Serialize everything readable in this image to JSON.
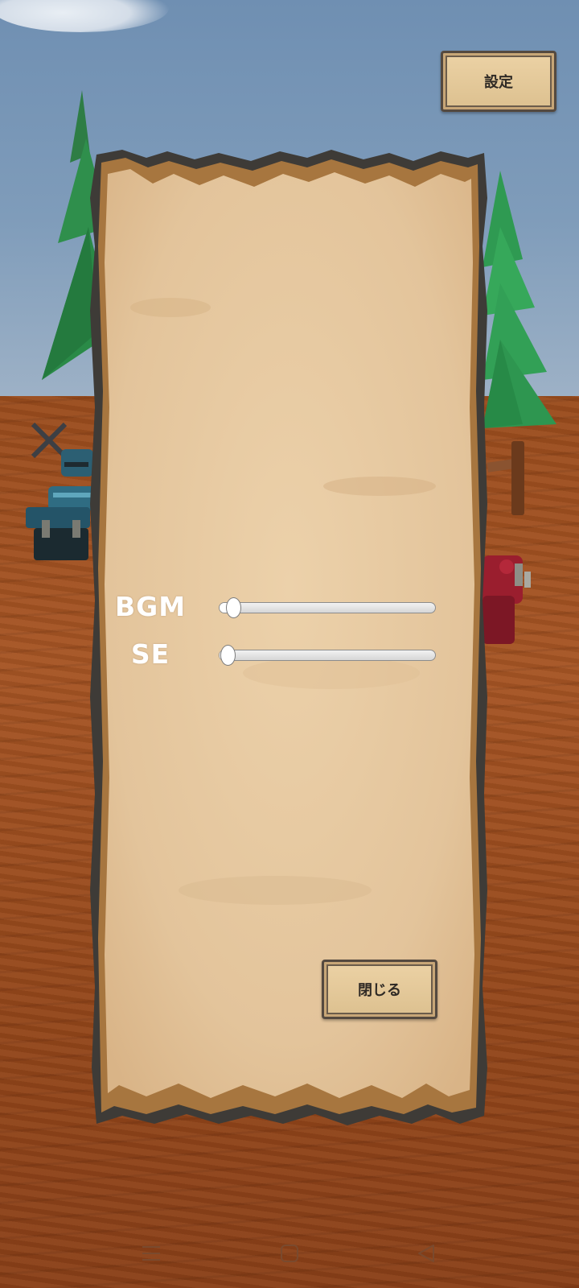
{
  "header": {
    "settings_label": "設定"
  },
  "settings_panel": {
    "bgm": {
      "label": "BGM",
      "value": 0.03
    },
    "se": {
      "label": "SE",
      "value": 0.0
    },
    "close_label": "閉じる"
  },
  "nav_bar": {
    "items": [
      {
        "name": "menu-icon"
      },
      {
        "name": "home-icon"
      },
      {
        "name": "back-icon"
      }
    ]
  },
  "colors": {
    "sky": "#7f9cba",
    "ground": "#a65524",
    "parchment": "#e6c79f",
    "parchment_edge": "#3e3b37",
    "tree_green": "#2f9a52"
  }
}
